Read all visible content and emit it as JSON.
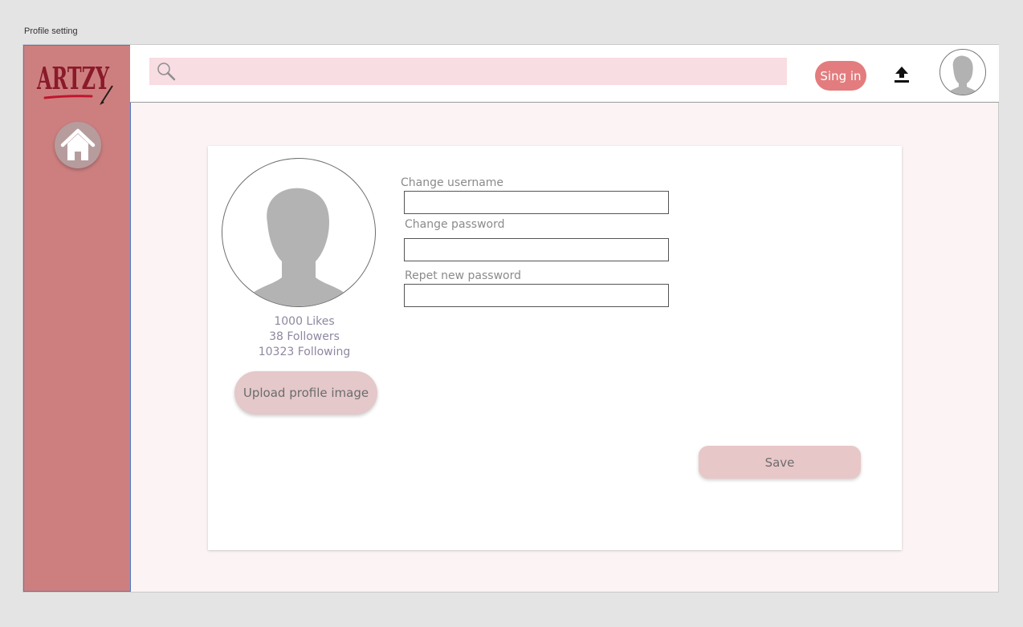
{
  "frame": {
    "title": "Profile setting"
  },
  "brand": {
    "logo_text": "ARTZY",
    "accent": "#cd7f7f",
    "logo_color": "#8a1a2a"
  },
  "sidebar": {
    "home_icon": "home-icon"
  },
  "topbar": {
    "search_placeholder": "",
    "search_icon": "search-icon",
    "signin_label": "Sing in",
    "upload_icon": "upload-icon",
    "avatar_icon": "user-silhouette-icon"
  },
  "profile": {
    "stats": {
      "likes": "1000 Likes",
      "followers": "38 Followers",
      "following": "10323 Following"
    },
    "upload_label": "Upload profile image"
  },
  "form": {
    "username_label": "Change username",
    "password_label": "Change password",
    "repeat_label": "Repet new password",
    "username_value": "",
    "password_value": "",
    "repeat_value": "",
    "save_label": "Save"
  }
}
